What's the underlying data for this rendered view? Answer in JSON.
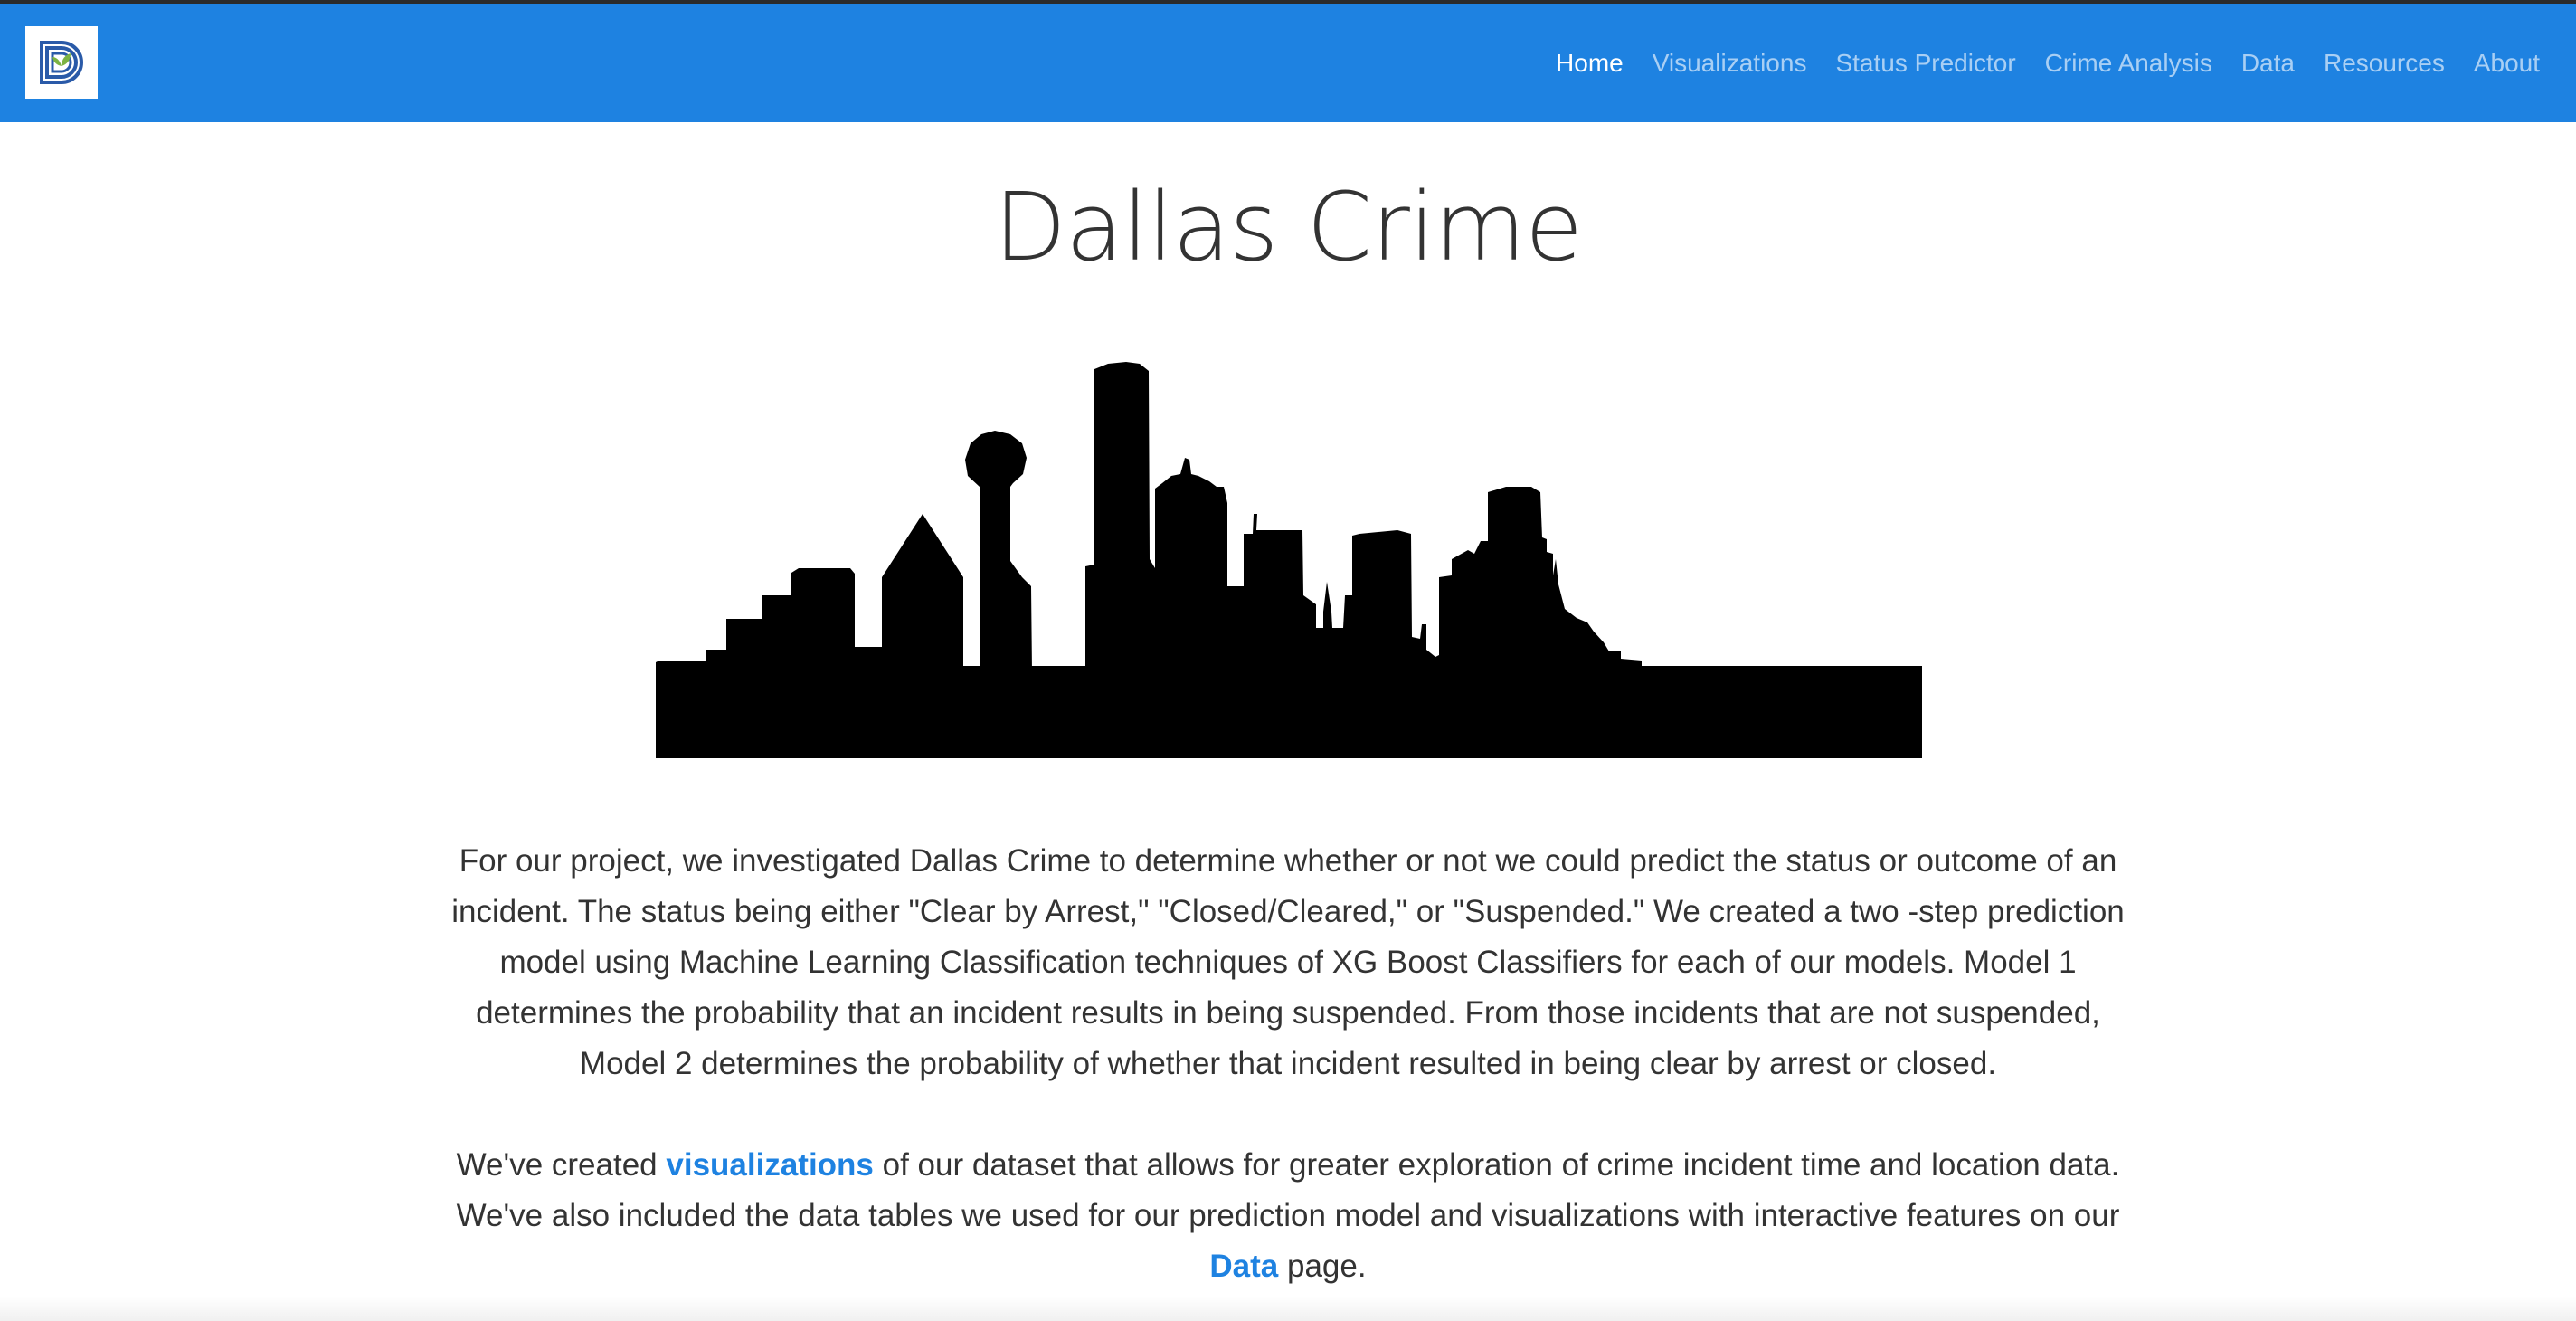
{
  "nav": {
    "logo_icon": "dallas-d-leaf-logo-icon",
    "items": [
      {
        "label": "Home",
        "active": true
      },
      {
        "label": "Visualizations",
        "active": false
      },
      {
        "label": "Status Predictor",
        "active": false
      },
      {
        "label": "Crime Analysis",
        "active": false
      },
      {
        "label": "Data",
        "active": false
      },
      {
        "label": "Resources",
        "active": false
      },
      {
        "label": "About",
        "active": false
      }
    ]
  },
  "main": {
    "title": "Dallas Crime",
    "skyline_icon": "dallas-skyline-silhouette-icon",
    "intro_paragraph": "For our project, we investigated Dallas Crime to determine whether or not we could predict the status or outcome of an incident. The status being either \"Clear by Arrest,\" \"Closed/Cleared,\" or \"Suspended.\" We created a two -step prediction model using Machine Learning Classification techniques of XG Boost Classifiers for each of our models. Model 1 determines the probability that an incident results in being suspended. From those incidents that are not suspended, Model 2 determines the probability of whether that incident resulted in being clear by arrest or closed.",
    "second_paragraph": {
      "before_link1": "We've created ",
      "link1": "visualizations",
      "between_links": " of our dataset that allows for greater exploration of crime incident time and location data. We've also included the data tables we used for our prediction model and visualizations with interactive features on our ",
      "link2": "Data",
      "after_link2": " page."
    }
  },
  "colors": {
    "navbar": "#1e82e1",
    "link": "#1e82e1",
    "text": "#333333",
    "logo_green": "#7cb342",
    "logo_blue": "#2a5aa8"
  }
}
